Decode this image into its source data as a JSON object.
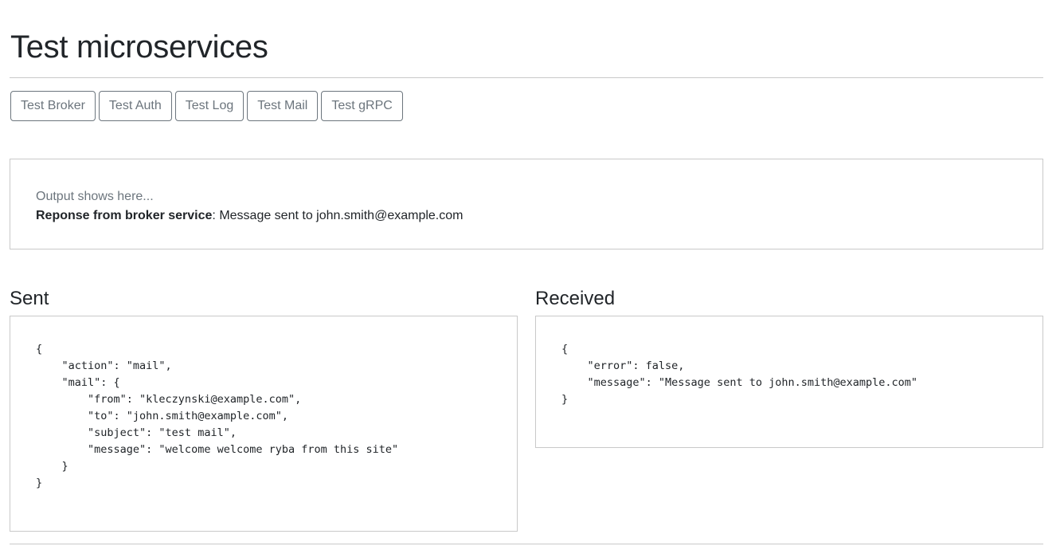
{
  "page": {
    "title": "Test microservices"
  },
  "buttons": [
    {
      "label": "Test Broker"
    },
    {
      "label": "Test Auth"
    },
    {
      "label": "Test Log"
    },
    {
      "label": "Test Mail"
    },
    {
      "label": "Test gRPC"
    }
  ],
  "output": {
    "placeholder": "Output shows here...",
    "response_label": "Reponse from broker service",
    "response_text": ": Message sent to john.smith@example.com"
  },
  "sent": {
    "heading": "Sent",
    "payload": "{\n    \"action\": \"mail\",\n    \"mail\": {\n        \"from\": \"kleczynski@example.com\",\n        \"to\": \"john.smith@example.com\",\n        \"subject\": \"test mail\",\n        \"message\": \"welcome welcome ryba from this site\"\n    }\n}"
  },
  "received": {
    "heading": "Received",
    "payload": "{\n    \"error\": false,\n    \"message\": \"Message sent to john.smith@example.com\"\n}"
  },
  "colors": {
    "text": "#212529",
    "muted": "#6c757d",
    "border": "#c9c9c9",
    "button_border": "#6c757d"
  }
}
